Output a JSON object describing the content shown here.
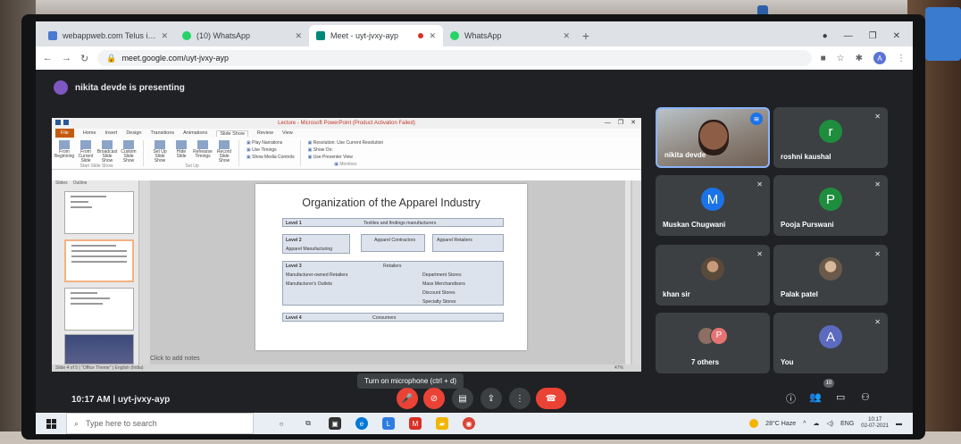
{
  "browser": {
    "tabs": [
      {
        "label": "webappweb.com Telus india",
        "color": "#4a7bd0",
        "active": false
      },
      {
        "label": "(10) WhatsApp",
        "color": "#25d366",
        "active": false
      },
      {
        "label": "Meet - uyt-jvxy-ayp",
        "color": "#00897b",
        "active": true
      },
      {
        "label": "WhatsApp",
        "color": "#25d366",
        "active": false
      }
    ],
    "url": "meet.google.com/uyt-jvxy-ayp",
    "profile_initial": "A"
  },
  "meet": {
    "presenting_text": "nikita devde is presenting",
    "meeting_code_time": "10:17 AM | uyt-jvxy-ayp",
    "mic_tooltip": "Turn on microphone (ctrl + d)",
    "participant_count": "10",
    "tiles": [
      {
        "name": "nikita devde",
        "type": "video",
        "speaking": true
      },
      {
        "name": "roshni kaushal",
        "type": "initial",
        "initial": "r",
        "color": "#1e8e3e"
      },
      {
        "name": "Muskan Chugwani",
        "type": "initial",
        "initial": "M",
        "color": "#1a73e8"
      },
      {
        "name": "Pooja Purswani",
        "type": "initial",
        "initial": "P",
        "color": "#1e8e3e"
      },
      {
        "name": "khan sir",
        "type": "photo"
      },
      {
        "name": "Palak patel",
        "type": "photo"
      },
      {
        "name": "7 others",
        "type": "group",
        "initial": "P"
      },
      {
        "name": "You",
        "type": "initial",
        "initial": "A",
        "color": "#5c6bc0"
      }
    ]
  },
  "ppt": {
    "window_title": "Lecture - Microsoft PowerPoint (Product Activation Failed)",
    "ribbon_tabs": [
      "File",
      "Home",
      "Insert",
      "Design",
      "Transitions",
      "Animations",
      "Slide Show",
      "Review",
      "View"
    ],
    "ribbon_groups": [
      {
        "name": "Start Slide Show",
        "buttons": [
          "From Beginning",
          "From Current Slide",
          "Broadcast Slide Show",
          "Custom Slide Show"
        ]
      },
      {
        "name": "Set Up",
        "buttons": [
          "Set Up Slide Show",
          "Hide Slide",
          "Rehearse Timings",
          "Record Slide Show"
        ]
      }
    ],
    "ribbon_checks": [
      "Play Narrations",
      "Use Timings",
      "Show Media Controls"
    ],
    "monitors": {
      "resolution": "Resolution: Use Current Resolution",
      "show_on": "Show On:",
      "presenter": "Use Presenter View",
      "group": "Monitors"
    },
    "pane_tabs": [
      "Slides",
      "Outline"
    ],
    "notes_placeholder": "Click to add notes",
    "status": "Slide 4 of 5  |  \"Office Theme\"  |  English (India)",
    "zoom": "47%",
    "slide": {
      "title": "Organization of the Apparel Industry",
      "level1": {
        "label": "Level 1",
        "text": "Textiles and findings manufacturers"
      },
      "level2": {
        "label": "Level 2",
        "text": "Apparel Manufacturing",
        "contractors": "Apparel Contractors",
        "retailers": "Apparel Retailers"
      },
      "level3": {
        "label": "Level 3",
        "header": "Retailers",
        "left": [
          "Manufacturer-owned Retailers",
          "Manufacturer's Outlets"
        ],
        "right": [
          "Department Stores",
          "Mass Merchandisers",
          "Discount Stores",
          "Specialty Stores"
        ]
      },
      "level4": {
        "label": "Level 4",
        "text": "Consumers"
      }
    }
  },
  "taskbar": {
    "search_placeholder": "Type here to search",
    "weather": "28°C Haze",
    "lang": "ENG",
    "time": "10:17",
    "date": "02-07-2021"
  },
  "colors": {
    "meet_bg": "#202124",
    "tile_bg": "#3c4043",
    "danger": "#ea4335",
    "ppt_file": "#c55a11"
  }
}
